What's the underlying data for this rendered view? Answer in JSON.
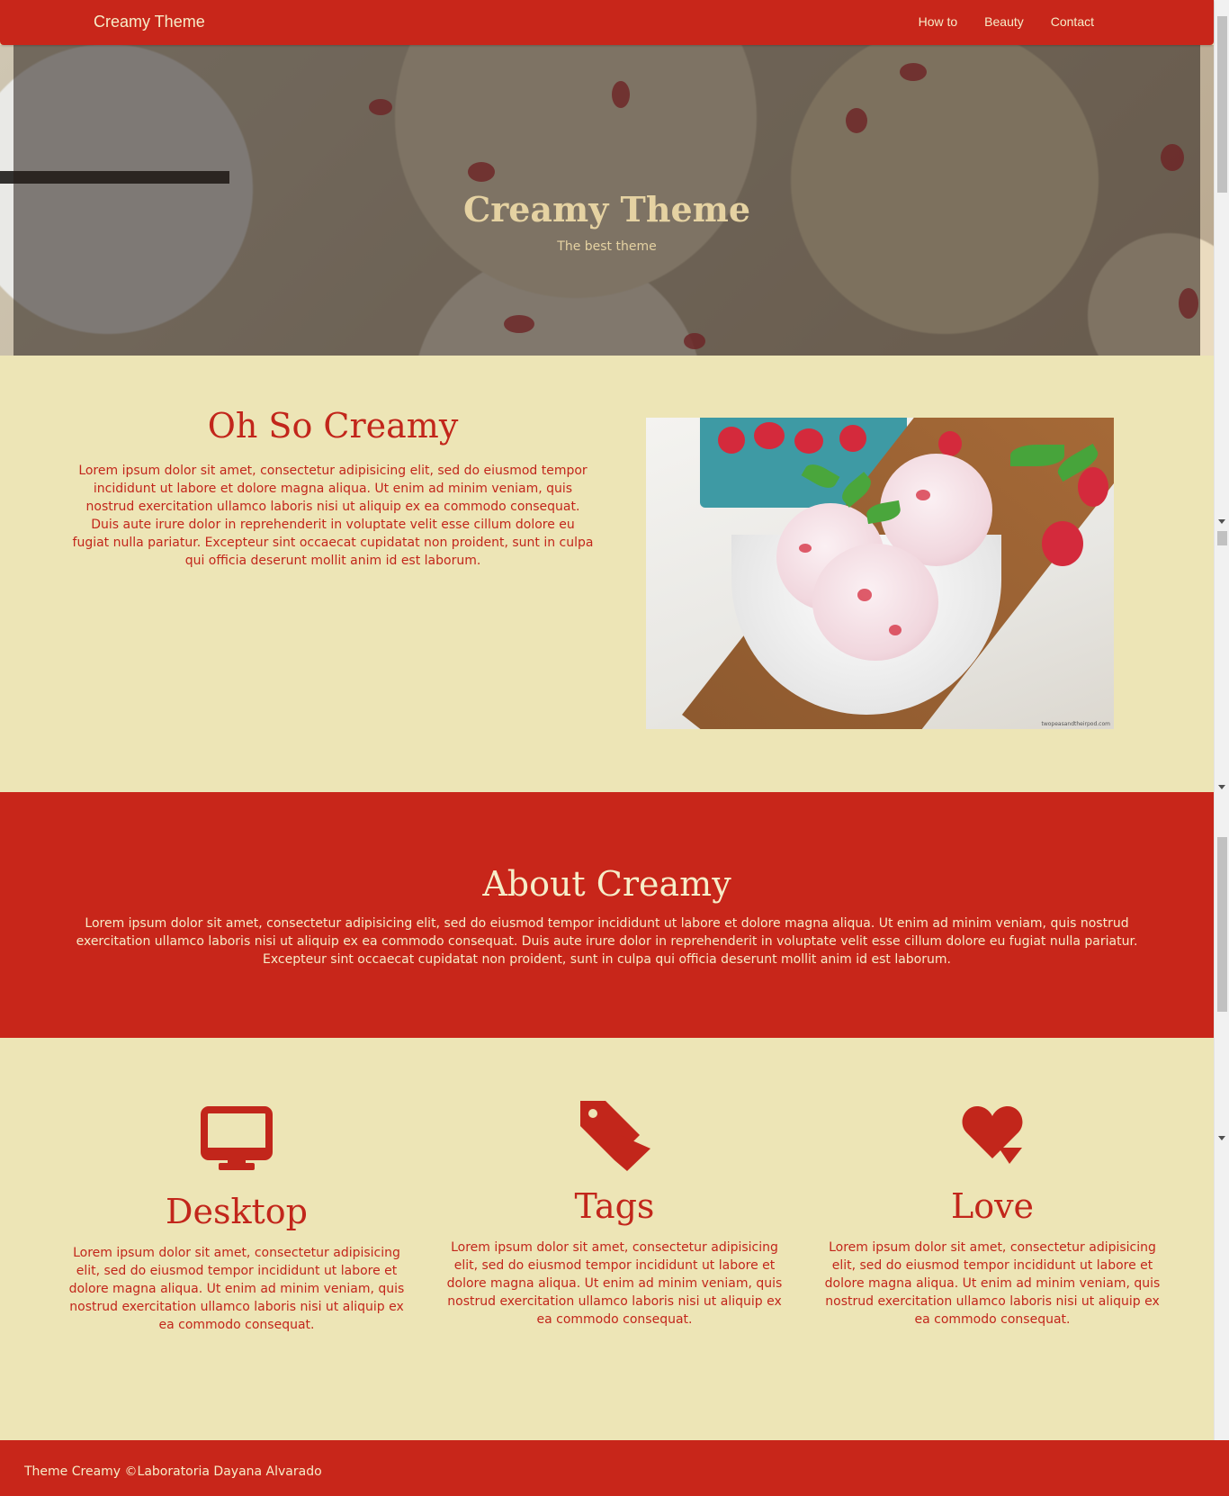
{
  "navbar": {
    "brand": "Creamy Theme",
    "links": [
      "How to",
      "Beauty",
      "Contact"
    ]
  },
  "hero": {
    "title": "Creamy Theme",
    "subtitle": "The best theme"
  },
  "intro": {
    "title": "Oh So Creamy",
    "text": "Lorem ipsum dolor sit amet, consectetur adipisicing elit, sed do eiusmod tempor incididunt ut labore et dolore magna aliqua. Ut enim ad minim veniam, quis nostrud exercitation ullamco laboris nisi ut aliquip ex ea commodo consequat. Duis aute irure dolor in reprehenderit in voluptate velit esse cillum dolore eu fugiat nulla pariatur. Excepteur sint occaecat cupidatat non proident, sunt in culpa qui officia deserunt mollit anim id est laborum.",
    "image_credit": "twopeasandtheirpod.com"
  },
  "about": {
    "title": "About Creamy",
    "text": "Lorem ipsum dolor sit amet, consectetur adipisicing elit, sed do eiusmod tempor incididunt ut labore et dolore magna aliqua. Ut enim ad minim veniam, quis nostrud exercitation ullamco laboris nisi ut aliquip ex ea commodo consequat. Duis aute irure dolor in reprehenderit in voluptate velit esse cillum dolore eu fugiat nulla pariatur. Excepteur sint occaecat cupidatat non proident, sunt in culpa qui officia deserunt mollit anim id est laborum."
  },
  "features": [
    {
      "icon": "desktop-icon",
      "title": "Desktop",
      "text": "Lorem ipsum dolor sit amet, consectetur adipisicing elit, sed do eiusmod tempor incididunt ut labore et dolore magna aliqua. Ut enim ad minim veniam, quis nostrud exercitation ullamco laboris nisi ut aliquip ex ea commodo consequat."
    },
    {
      "icon": "tag-icon",
      "title": "Tags",
      "text": "Lorem ipsum dolor sit amet, consectetur adipisicing elit, sed do eiusmod tempor incididunt ut labore et dolore magna aliqua. Ut enim ad minim veniam, quis nostrud exercitation ullamco laboris nisi ut aliquip ex ea commodo consequat."
    },
    {
      "icon": "heart-icon",
      "title": "Love",
      "text": "Lorem ipsum dolor sit amet, consectetur adipisicing elit, sed do eiusmod tempor incididunt ut labore et dolore magna aliqua. Ut enim ad minim veniam, quis nostrud exercitation ullamco laboris nisi ut aliquip ex ea commodo consequat."
    }
  ],
  "footer": {
    "text": "Theme Creamy ©Laboratoria Dayana Alvarado"
  },
  "colors": {
    "primary_red": "#c8261a",
    "cream": "#ede5b6",
    "light_text": "#f6edc8"
  }
}
